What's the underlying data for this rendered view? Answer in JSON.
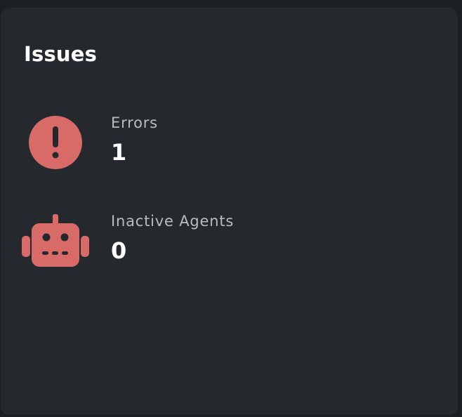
{
  "colors": {
    "page_background": "#1b1e22",
    "card_background": "#25282d",
    "accent": "#d86a68",
    "label_text": "#b8bcc2",
    "value_text": "#ffffff"
  },
  "panel": {
    "title": "Issues",
    "metrics": [
      {
        "label": "Errors",
        "value": "1",
        "icon": "exclamation-circle-icon"
      },
      {
        "label": "Inactive Agents",
        "value": "0",
        "icon": "robot-icon"
      }
    ]
  }
}
